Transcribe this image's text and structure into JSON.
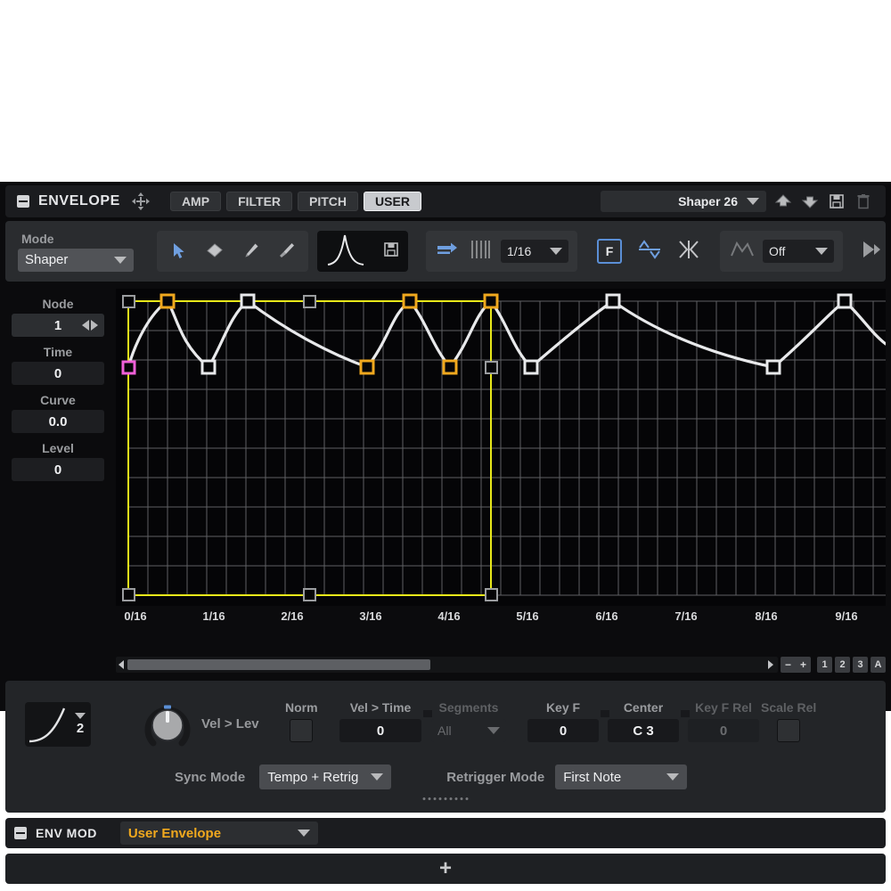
{
  "titlebar": {
    "collapse_icon": "minus-box-icon",
    "title": "ENVELOPE",
    "move_icon": "move-cross-icon",
    "tabs": [
      {
        "label": "AMP",
        "active": false
      },
      {
        "label": "FILTER",
        "active": false
      },
      {
        "label": "PITCH",
        "active": false
      },
      {
        "label": "USER",
        "active": true
      }
    ],
    "preset_name": "Shaper 26",
    "preset_dropdown_icon": "chevron-down-icon",
    "prev_preset_icon": "arrow-up-icon",
    "next_preset_icon": "arrow-down-icon",
    "save_icon": "floppy-disk-icon",
    "delete_icon": "trash-icon"
  },
  "toolbar": {
    "mode_label": "Mode",
    "mode_value": "Shaper",
    "tools": [
      {
        "name": "select-arrow-tool",
        "active": true
      },
      {
        "name": "eraser-tool",
        "active": false
      },
      {
        "name": "pencil-tool",
        "active": false
      },
      {
        "name": "paintbrush-tool",
        "active": false
      }
    ],
    "curve_shape_icon": "envelope-peak-icon",
    "store_shape_icon": "floppy-disk-icon",
    "snap_icon": "arrow-right-snap-icon",
    "grid_icon": "grid-lines-icon",
    "grid_value": "1/16",
    "fixed_label": "F",
    "bipolar_icon": "bipolar-wave-icon",
    "mirror_icon": "mirror-icon",
    "fill_icon": "fill-envelope-icon",
    "fill_value": "Off",
    "play_icon": "play-end-icon"
  },
  "node_panel": {
    "node_label": "Node",
    "node_value": "1",
    "time_label": "Time",
    "time_value": "0",
    "curve_label": "Curve",
    "curve_value": "0.0",
    "level_label": "Level",
    "level_value": "0"
  },
  "graph": {
    "x_ticks": [
      "0/16",
      "1/16",
      "2/16",
      "3/16",
      "4/16",
      "5/16",
      "6/16",
      "7/16",
      "8/16",
      "9/16"
    ],
    "selection_color": "#e8e81a",
    "selected_node_color": "#f0a81e",
    "active_node_color": "#f060d8",
    "curve_color": "#e8e9eb",
    "grid_color": "#6a6c70",
    "background_color": "#050507"
  },
  "chart_data": {
    "type": "line",
    "title": "User Envelope Shaper",
    "xlabel": "",
    "ylabel": "",
    "x_ticks": [
      "0/16",
      "1/16",
      "2/16",
      "3/16",
      "4/16",
      "5/16",
      "6/16",
      "7/16",
      "8/16",
      "9/16"
    ],
    "xlim": [
      0,
      9.6
    ],
    "ylim": [
      0,
      1
    ],
    "grid": true,
    "nodes": [
      {
        "index": 1,
        "x": 0.0,
        "level": 0.42,
        "curve": 0.0,
        "state": "active"
      },
      {
        "index": 2,
        "x": 0.52,
        "level": 1.0,
        "curve": 0.0,
        "state": "selected"
      },
      {
        "index": 3,
        "x": 1.05,
        "level": 0.44,
        "curve": 0.0,
        "state": "normal"
      },
      {
        "index": 4,
        "x": 1.55,
        "level": 1.0,
        "curve": 0.0,
        "state": "normal"
      },
      {
        "index": 5,
        "x": 3.0,
        "level": 0.44,
        "curve": 0.0,
        "state": "selected"
      },
      {
        "index": 6,
        "x": 3.48,
        "level": 1.0,
        "curve": 0.0,
        "state": "selected"
      },
      {
        "index": 7,
        "x": 3.95,
        "level": 0.44,
        "curve": 0.0,
        "state": "selected"
      },
      {
        "index": 8,
        "x": 4.46,
        "level": 1.0,
        "curve": 0.0,
        "state": "selected"
      },
      {
        "index": 9,
        "x": 4.95,
        "level": 0.44,
        "curve": 0.0,
        "state": "normal"
      },
      {
        "index": 10,
        "x": 5.97,
        "level": 1.0,
        "curve": 0.0,
        "state": "normal"
      },
      {
        "index": 11,
        "x": 8.0,
        "level": 0.44,
        "curve": 0.0,
        "state": "normal"
      },
      {
        "index": 12,
        "x": 9.0,
        "level": 1.0,
        "curve": 0.0,
        "state": "normal"
      },
      {
        "index": 13,
        "x": 9.6,
        "level": 0.72,
        "curve": 0.0,
        "state": "normal"
      }
    ],
    "selection_rect": {
      "x0": 0.0,
      "x1": 4.46,
      "y0": 0.0,
      "y1": 1.0
    }
  },
  "scrollbar": {
    "left_arrow_icon": "triangle-left-icon",
    "right_arrow_icon": "triangle-right-icon",
    "zoom_out_label": "−",
    "zoom_in_label": "+",
    "zoom_presets": [
      "1",
      "2",
      "3",
      "A"
    ]
  },
  "bottom": {
    "curve_preview_icon": "curve-shape-icon",
    "curve_preview_number": "2",
    "knob_label": "Vel > Lev",
    "norm_label": "Norm",
    "vel_time_label": "Vel > Time",
    "vel_time_value": "0",
    "segments_label": "Segments",
    "segments_value": "All",
    "keyf_label": "Key F",
    "keyf_value": "0",
    "center_label": "Center",
    "center_value": "C  3",
    "keyfrel_label": "Key F Rel",
    "keyfrel_value": "0",
    "scalerel_label": "Scale Rel",
    "sync_mode_label": "Sync Mode",
    "sync_mode_value": "Tempo + Retrig",
    "retrigger_mode_label": "Retrigger Mode",
    "retrigger_mode_value": "First Note"
  },
  "envmod": {
    "collapse_icon": "minus-box-icon",
    "title": "ENV MOD",
    "source_value": "User Envelope",
    "add_label": "+"
  }
}
